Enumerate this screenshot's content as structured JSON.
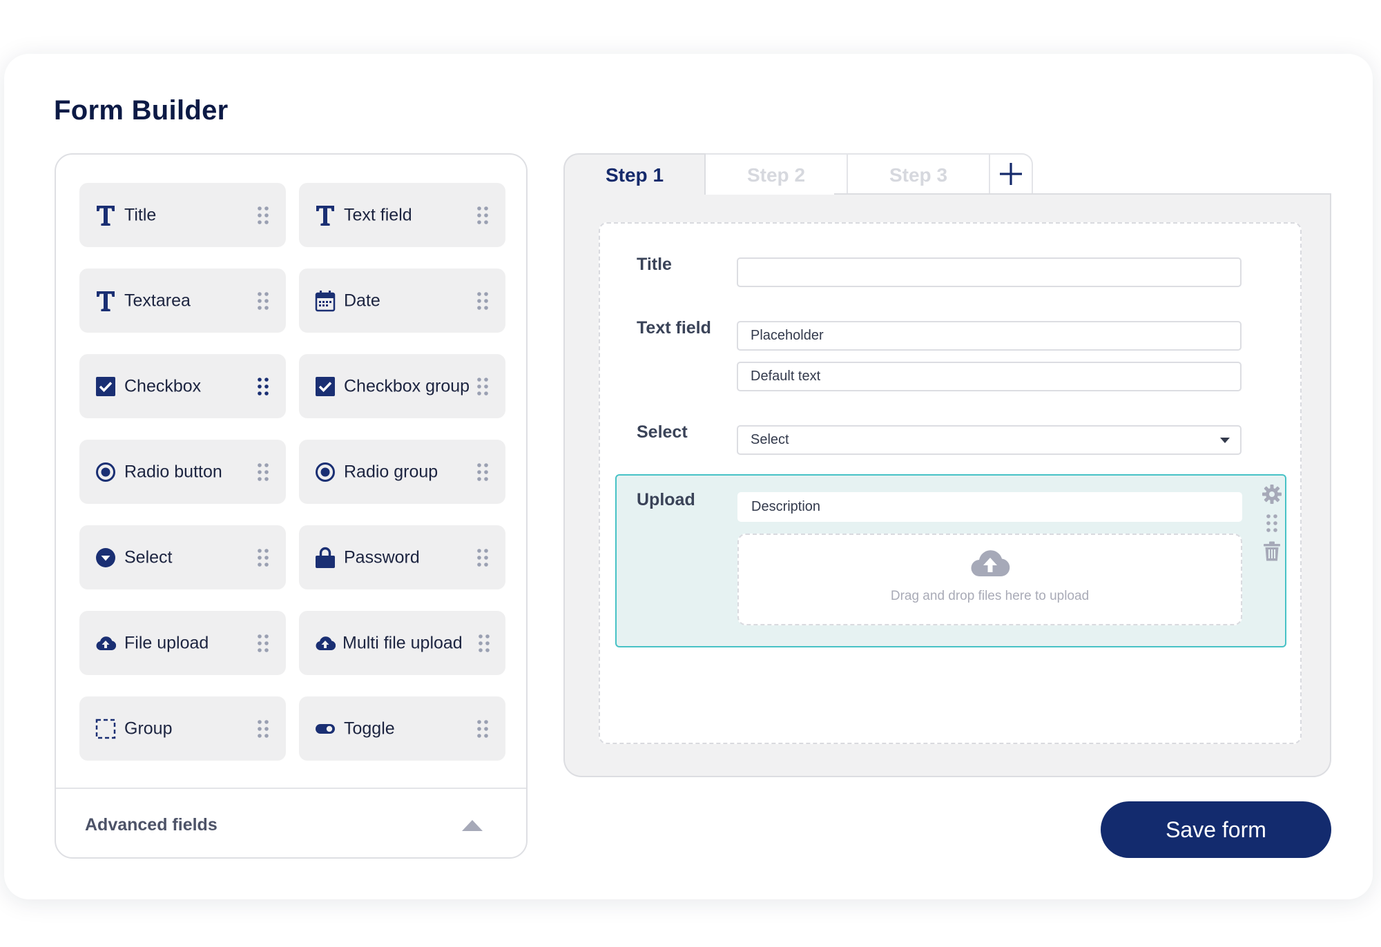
{
  "page": {
    "title": "Form Builder"
  },
  "palette": {
    "items": [
      {
        "label": "Title",
        "icon": "text-icon"
      },
      {
        "label": "Text field",
        "icon": "text-icon"
      },
      {
        "label": "Textarea",
        "icon": "text-icon"
      },
      {
        "label": "Date",
        "icon": "calendar-icon"
      },
      {
        "label": "Checkbox",
        "icon": "checkbox-icon"
      },
      {
        "label": "Checkbox group",
        "icon": "checkbox-icon"
      },
      {
        "label": "Radio button",
        "icon": "radio-icon"
      },
      {
        "label": "Radio group",
        "icon": "radio-icon"
      },
      {
        "label": "Select",
        "icon": "select-icon"
      },
      {
        "label": "Password",
        "icon": "lock-icon"
      },
      {
        "label": "File upload",
        "icon": "cloud-upload-icon"
      },
      {
        "label": "Multi file upload",
        "icon": "cloud-upload-icon"
      },
      {
        "label": "Group",
        "icon": "dashed-box-icon"
      },
      {
        "label": "Toggle",
        "icon": "toggle-icon"
      }
    ],
    "advanced_label": "Advanced fields"
  },
  "steps": {
    "tabs": [
      {
        "label": "Step 1",
        "active": true
      },
      {
        "label": "Step 2",
        "active": false
      },
      {
        "label": "Step 3",
        "active": false
      }
    ]
  },
  "form": {
    "title_label": "Title",
    "title_value": "",
    "text_label": "Text field",
    "text_placeholder": "Placeholder",
    "text_default": "Default text",
    "select_label": "Select",
    "select_value": "Select",
    "upload_label": "Upload",
    "upload_description": "Description",
    "upload_hint": "Drag and drop files here to upload"
  },
  "actions": {
    "save_label": "Save form"
  },
  "colors": {
    "brand": "#132b6e",
    "icon": "#1a2f73",
    "selected_border": "#47c2c6",
    "selected_bg": "#e6f2f2",
    "tile_bg": "#efeff0",
    "inactive_tab_text": "#d6d8de"
  }
}
